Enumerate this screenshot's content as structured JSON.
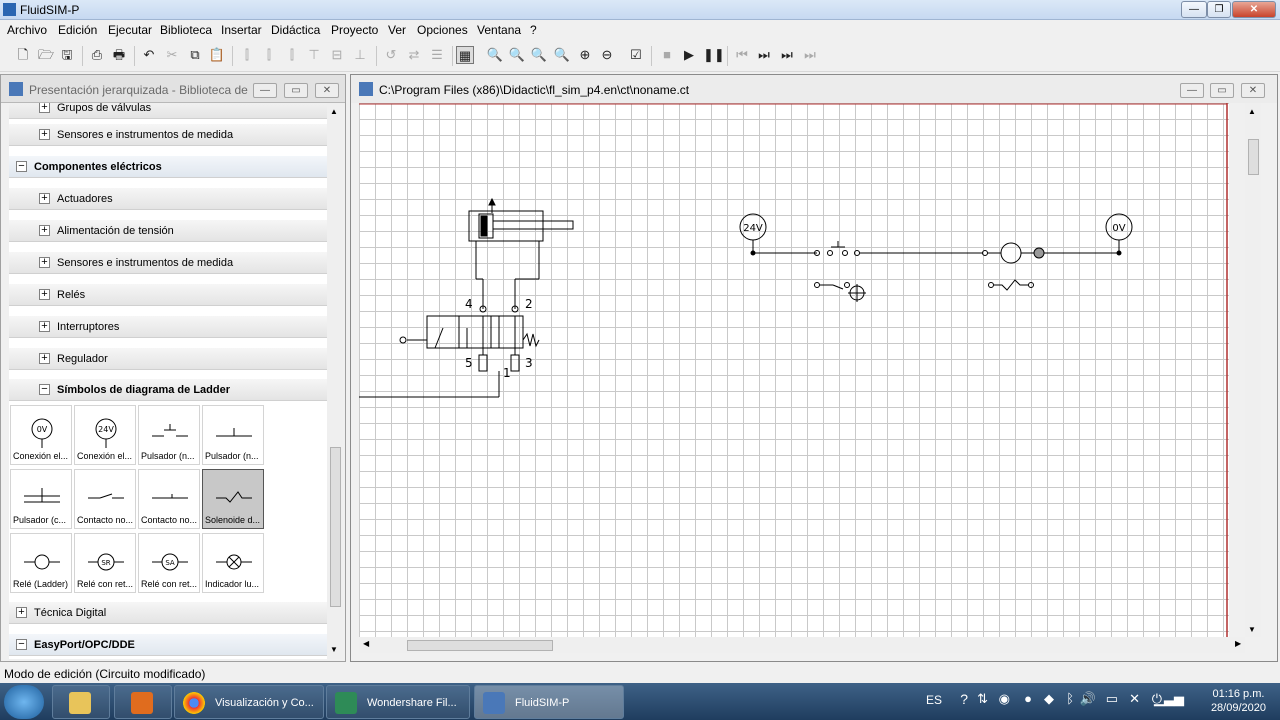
{
  "window": {
    "title": "FluidSIM-P"
  },
  "menu": [
    "Archivo",
    "Edición",
    "Ejecutar",
    "Biblioteca",
    "Insertar",
    "Didáctica",
    "Proyecto",
    "Ver",
    "Opciones",
    "Ventana",
    "?"
  ],
  "library": {
    "title": "Presentación jerarquizada - Biblioteca de c...",
    "rows": [
      {
        "label": "Grupos de válvulas",
        "level": 2,
        "sign": "+"
      },
      {
        "label": "Sensores e instrumentos de medida",
        "level": 2,
        "sign": "+"
      },
      {
        "label": "Componentes eléctricos",
        "level": 1,
        "sign": "−"
      },
      {
        "label": "Actuadores",
        "level": 2,
        "sign": "+"
      },
      {
        "label": "Alimentación de tensión",
        "level": 2,
        "sign": "+"
      },
      {
        "label": "Sensores e instrumentos de medida",
        "level": 2,
        "sign": "+"
      },
      {
        "label": "Relés",
        "level": 2,
        "sign": "+"
      },
      {
        "label": "Interruptores",
        "level": 2,
        "sign": "+"
      },
      {
        "label": "Regulador",
        "level": 2,
        "sign": "+"
      },
      {
        "label": "Símbolos de diagrama de Ladder",
        "level": 2,
        "sign": "−"
      }
    ],
    "symbols": [
      {
        "caption": "Conexión el...",
        "glyph": "0V"
      },
      {
        "caption": "Conexión el...",
        "glyph": "24V"
      },
      {
        "caption": "Pulsador (n...",
        "glyph": "pb-no"
      },
      {
        "caption": "Pulsador (n...",
        "glyph": "pb-nc"
      },
      {
        "caption": "Pulsador (c...",
        "glyph": "pb-combo"
      },
      {
        "caption": "Contacto no...",
        "glyph": "contact-no"
      },
      {
        "caption": "Contacto no...",
        "glyph": "contact-nc"
      },
      {
        "caption": "Solenoide d...",
        "glyph": "solenoid",
        "selected": true
      },
      {
        "caption": "Relé (Ladder)",
        "glyph": "relay"
      },
      {
        "caption": "Relé con ret...",
        "glyph": "SR"
      },
      {
        "caption": "Relé con ret...",
        "glyph": "SA"
      },
      {
        "caption": "Indicador lu...",
        "glyph": "lamp"
      }
    ],
    "bottom_rows": [
      {
        "label": "Técnica Digital",
        "sign": "+"
      },
      {
        "label": "EasyPort/OPC/DDE",
        "sign": "−"
      }
    ]
  },
  "circuit": {
    "title": "C:\\Program Files (x86)\\Didactic\\fl_sim_p4.en\\ct\\noname.ct",
    "labels": {
      "port4": "4",
      "port2": "2",
      "port5": "5",
      "port1": "1",
      "port3": "3",
      "v24": "24V",
      "v0": "0V"
    }
  },
  "status": "Modo de edición (Circuito modificado)",
  "taskbar": {
    "apps": [
      "Visualización y Co...",
      "Wondershare Fil...",
      "FluidSIM-P"
    ],
    "lang": "ES",
    "time": "01:16 p.m.",
    "date": "28/09/2020"
  }
}
